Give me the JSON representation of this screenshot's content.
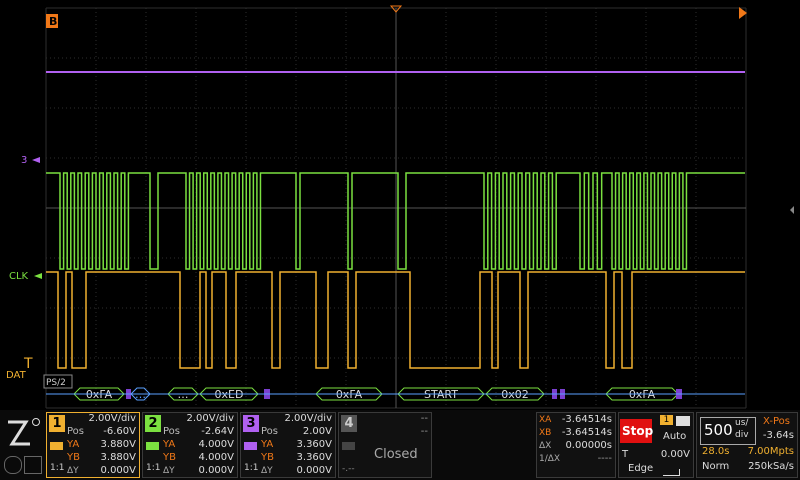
{
  "header": {
    "marker": "B"
  },
  "waveform_labels": {
    "ch3": "3",
    "clk": "CLK",
    "dat": "DAT"
  },
  "decode": {
    "protocol": "PS/2",
    "packets": [
      "0xFA",
      "…",
      "…",
      "0xED",
      "0xFA",
      "START",
      "0x02",
      "0xFA"
    ]
  },
  "channels": [
    {
      "num": "1",
      "color": "#f0b030",
      "scale": "2.00V/div",
      "pos_label": "Pos",
      "pos": "-6.60V",
      "ya_label": "YA",
      "ya": "3.880V",
      "yb_label": "YB",
      "yb": "3.880V",
      "dy_label": "ΔY",
      "dy": "0.000V",
      "coupling": "1:1"
    },
    {
      "num": "2",
      "color": "#7be040",
      "scale": "2.00V/div",
      "pos_label": "Pos",
      "pos": "-2.64V",
      "ya_label": "YA",
      "ya": "4.000V",
      "yb_label": "YB",
      "yb": "4.000V",
      "dy_label": "ΔY",
      "dy": "0.000V",
      "coupling": "1:1"
    },
    {
      "num": "3",
      "color": "#b060f0",
      "scale": "2.00V/div",
      "pos_label": "Pos",
      "pos": "2.00V",
      "ya_label": "YA",
      "ya": "3.360V",
      "yb_label": "YB",
      "yb": "3.360V",
      "dy_label": "ΔY",
      "dy": "0.000V",
      "coupling": "1:1"
    }
  ],
  "ch4": {
    "num": "4",
    "dash1": "--",
    "dash2": "--",
    "dash3": "-.--",
    "status": "Closed"
  },
  "cursors": {
    "xa_label": "XA",
    "xa": "-3.64514s",
    "xb_label": "XB",
    "xb": "-3.64514s",
    "dx_label": "ΔX",
    "dx": "0.00000s",
    "inv_label": "1/ΔX",
    "inv": "----"
  },
  "trigger": {
    "state": "Stop",
    "source": "1",
    "mode": "Auto",
    "t_label": "T",
    "level": "0.00V",
    "type": "Edge"
  },
  "timebase": {
    "value": "500",
    "unit_top": "us/",
    "unit_bottom": "div",
    "xpos_label": "X-Pos",
    "xpos": "-3.64s",
    "duration": "28.0s",
    "mem": "7.00Mpts",
    "acq": "Norm",
    "rate": "250kSa/s"
  },
  "colors": {
    "ch1": "#f0b030",
    "ch2": "#7be040",
    "ch3": "#b060f0",
    "decode": "#7be040",
    "stop": "#e01010",
    "orange": "#f07818"
  }
}
